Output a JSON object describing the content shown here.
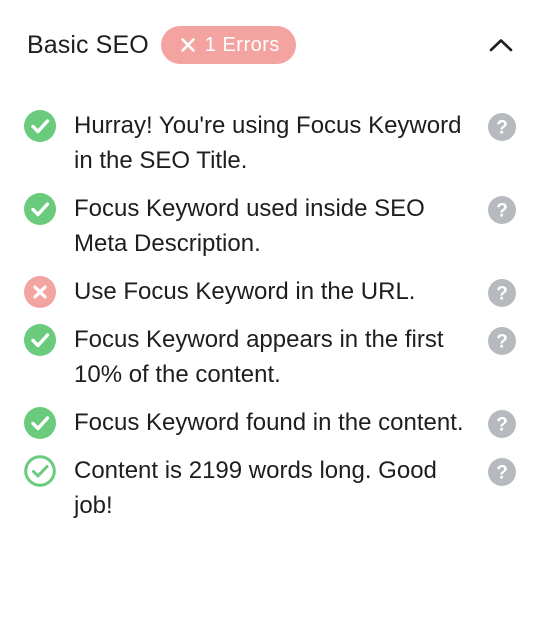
{
  "header": {
    "title": "Basic SEO",
    "badge_label": "1 Errors",
    "collapse_icon": "chevron-up-icon"
  },
  "colors": {
    "pass": "#6bcb7c",
    "fail": "#f3a3a0",
    "help": "#b6b9bd"
  },
  "checks": [
    {
      "status": "pass",
      "icon": "check-circle-icon",
      "text": "Hurray! You're using Focus Keyword in the SEO Title."
    },
    {
      "status": "pass",
      "icon": "check-circle-icon",
      "text": "Focus Keyword used inside SEO Meta Description."
    },
    {
      "status": "fail",
      "icon": "x-circle-icon",
      "text": "Use Focus Keyword in the URL."
    },
    {
      "status": "pass",
      "icon": "check-circle-icon",
      "text": "Focus Keyword appears in the first 10% of the content."
    },
    {
      "status": "pass",
      "icon": "check-circle-icon",
      "text": "Focus Keyword found in the content."
    },
    {
      "status": "pass-outline",
      "icon": "check-circle-outline-icon",
      "text": "Content is 2199 words long. Good job!"
    }
  ]
}
